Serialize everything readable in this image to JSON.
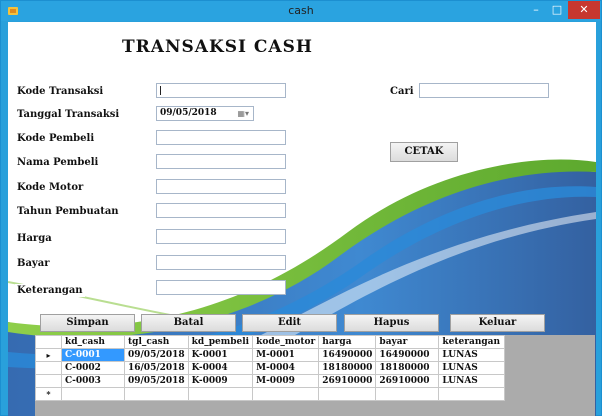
{
  "window": {
    "title": "cash",
    "minimize": "–",
    "maximize": "□",
    "close": "✕"
  },
  "form": {
    "heading": "TRANSAKSI CASH",
    "labels": {
      "kode_transaksi": "Kode Transaksi",
      "tanggal_transaksi": "Tanggal Transaksi",
      "kode_pembeli": "Kode Pembeli",
      "nama_pembeli": "Nama Pembeli",
      "kode_motor": "Kode Motor",
      "tahun_pembuatan": "Tahun Pembuatan",
      "harga": "Harga",
      "bayar": "Bayar",
      "keterangan": "Keterangan",
      "cari": "Cari"
    },
    "values": {
      "tanggal_transaksi": "09/05/2018"
    },
    "date_icon": "calendar-dropdown-icon"
  },
  "buttons": {
    "cetak": "CETAK",
    "simpan": "Simpan",
    "batal": "Batal",
    "edit": "Edit",
    "hapus": "Hapus",
    "keluar": "Keluar"
  },
  "table": {
    "columns": [
      "kd_cash",
      "tgl_cash",
      "kd_pembeli",
      "kode_motor",
      "harga",
      "bayar",
      "keterangan"
    ],
    "rows": [
      [
        "C-0001",
        "09/05/2018",
        "K-0001",
        "M-0001",
        "16490000",
        "16490000",
        "LUNAS"
      ],
      [
        "C-0002",
        "16/05/2018",
        "K-0004",
        "M-0004",
        "18180000",
        "18180000",
        "LUNAS"
      ],
      [
        "C-0003",
        "09/05/2018",
        "K-0009",
        "M-0009",
        "26910000",
        "26910000",
        "LUNAS"
      ]
    ],
    "current_row_marker": "▸",
    "new_row_marker": "*"
  },
  "colors": {
    "titlebar": "#2aa3e0",
    "close": "#c7372f",
    "selection": "#3399ff",
    "swoosh_green": "#6fbf3a",
    "swoosh_blue": "#1b5fae"
  }
}
